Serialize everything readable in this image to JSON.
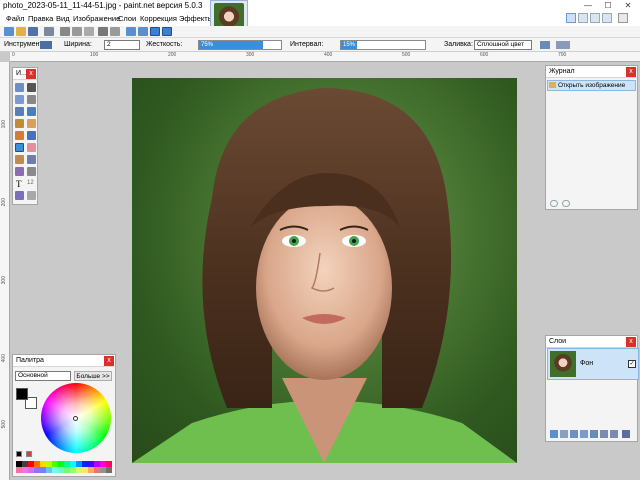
{
  "window": {
    "title": "photo_2023-05-11_11-44-51.jpg - paint.net версия 5.0.3",
    "controls": {
      "minimize": "—",
      "maximize": "☐",
      "close": "✕"
    }
  },
  "menu": [
    "Файл",
    "Правка",
    "Вид",
    "Изображение",
    "Слои",
    "Коррекция",
    "Эффекты"
  ],
  "image_tab": {
    "close": "✕"
  },
  "options": {
    "tool_label": "Инструмент:",
    "width_label": "Ширина:",
    "width_value": "2",
    "hardness_label": "Жесткость:",
    "hardness_value": "75%",
    "interval_label": "Интервал:",
    "interval_value": "15%",
    "fill_label": "Заливка:",
    "fill_value": "Сплошной цвет"
  },
  "rulers": {
    "h": [
      "0",
      "100",
      "200",
      "300",
      "400",
      "500",
      "600",
      "700"
    ],
    "v": [
      "100",
      "200",
      "300",
      "400",
      "500",
      "600"
    ]
  },
  "tools_panel": {
    "title": "И...",
    "close": "x",
    "text_tool": "T",
    "number_tool": "12"
  },
  "history_panel": {
    "title": "Журнал",
    "close": "x",
    "items": [
      "Открыть изображение"
    ]
  },
  "layers_panel": {
    "title": "Слои",
    "close": "x",
    "layer_name": "Фон",
    "visible_check": "✓"
  },
  "palette_panel": {
    "title": "Палитра",
    "close": "x",
    "mode": "Основной",
    "more": "Больше >>"
  },
  "colors": {
    "accent": "#3b8fd8",
    "primary": "#000000",
    "secondary": "#ffffff",
    "close_red": "#d9302a",
    "palette_strip": [
      "#000000",
      "#404040",
      "#ff0000",
      "#ff6a00",
      "#ffd800",
      "#b6ff00",
      "#4cff00",
      "#00ff21",
      "#00ff90",
      "#00ffff",
      "#0094ff",
      "#0026ff",
      "#4800ff",
      "#b200ff",
      "#ff00dc",
      "#ff006e"
    ]
  }
}
